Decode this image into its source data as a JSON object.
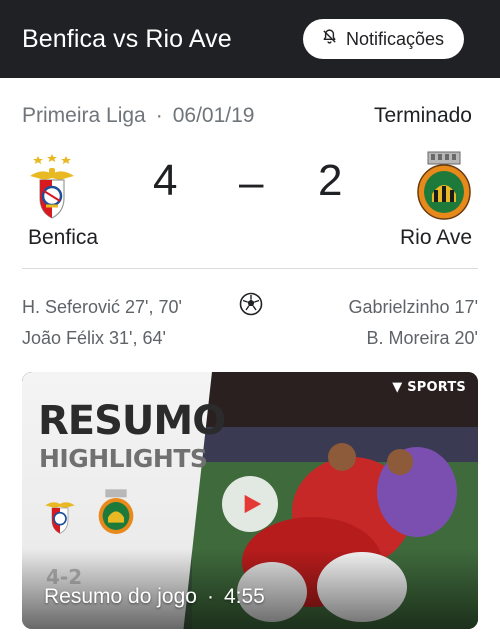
{
  "header": {
    "title": "Benfica vs Rio Ave",
    "notify_label": "Notificações",
    "notify_icon": "bell-off-icon"
  },
  "match": {
    "competition": "Primeira Liga",
    "separator": "·",
    "date": "06/01/19",
    "status": "Terminado",
    "home": {
      "name": "Benfica",
      "score": "4",
      "crest_icon": "benfica-crest-icon"
    },
    "away": {
      "name": "Rio Ave",
      "score": "2",
      "crest_icon": "rio-ave-crest-icon"
    },
    "score_separator": "–"
  },
  "scorers": {
    "home": [
      "H. Seferović 27', 70'",
      "João Félix 31', 64'"
    ],
    "away": [
      "Gabrielzinho 17'",
      "B. Moreira 20'"
    ],
    "icon": "soccer-ball-icon"
  },
  "video": {
    "overlay_title": "RESUMO",
    "overlay_subtitle": "HIGHLIGHTS",
    "overlay_score": "4-2",
    "brand": "SPORTS",
    "caption": "Resumo do jogo",
    "caption_separator": "·",
    "duration": "4:55",
    "play_icon": "play-icon"
  },
  "colors": {
    "header_bg": "#202124",
    "benfica_red": "#d71920",
    "rio_ave_green": "#1e7a3a",
    "gold": "#e8b923"
  }
}
